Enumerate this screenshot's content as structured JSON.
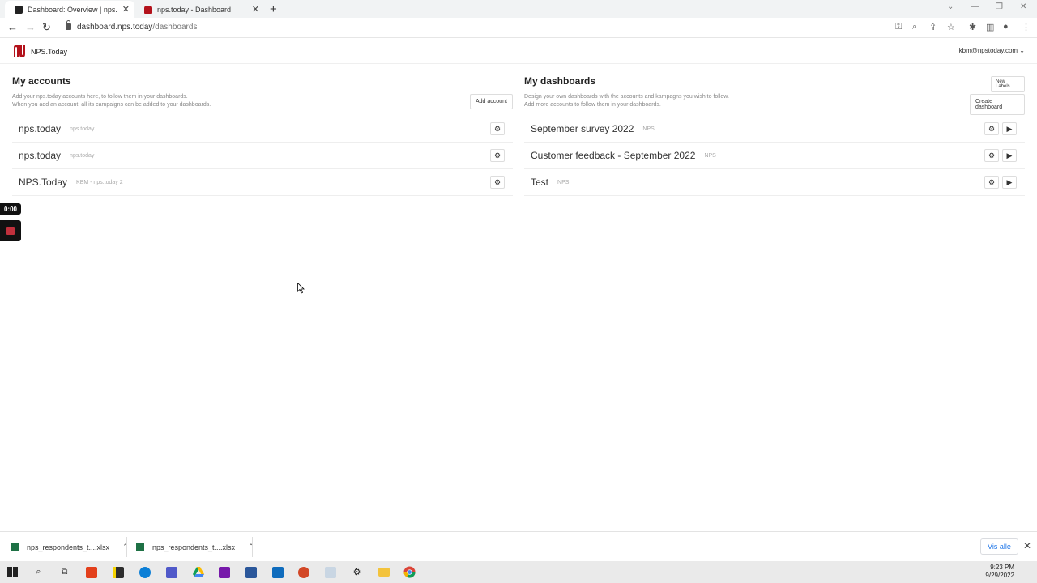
{
  "browser": {
    "tabs": [
      {
        "title": "Dashboard: Overview | nps.today",
        "active": true
      },
      {
        "title": "nps.today - Dashboard",
        "active": false
      }
    ],
    "url_host": "dashboard.nps.today",
    "url_path": "/dashboards"
  },
  "app": {
    "logo_text": "NPS.Today",
    "user_email": "kbm@npstoday.com",
    "brand_color": "#b3121b"
  },
  "accounts": {
    "title": "My accounts",
    "description_line1": "Add your nps.today accounts here, to follow them in your dashboards.",
    "description_line2": "When you add an account, all its campaigns can be added to your dashboards.",
    "add_button": "Add account",
    "items": [
      {
        "name": "nps.today",
        "sub": "nps.today"
      },
      {
        "name": "nps.today",
        "sub": "nps.today"
      },
      {
        "name": "NPS.Today",
        "sub": "KBM - nps.today 2"
      }
    ]
  },
  "dashboards": {
    "title": "My dashboards",
    "description_line1": "Design your own dashboards with the accounts and kampagns you wish to follow.",
    "description_line2": "Add more accounts to follow them in your dashboards.",
    "new_labels_button": "New Labels",
    "create_button": "Create dashboard",
    "items": [
      {
        "name": "September survey 2022",
        "sub": "NPS"
      },
      {
        "name": "Customer feedback - September 2022",
        "sub": "NPS"
      },
      {
        "name": "Test",
        "sub": "NPS"
      }
    ]
  },
  "recorder": {
    "time": "0:00"
  },
  "downloads": {
    "items": [
      "nps_respondents_t....xlsx",
      "nps_respondents_t....xlsx"
    ],
    "show_all": "Vis alle"
  },
  "taskbar": {
    "time": "9:23 PM",
    "date": "9/29/2022"
  }
}
